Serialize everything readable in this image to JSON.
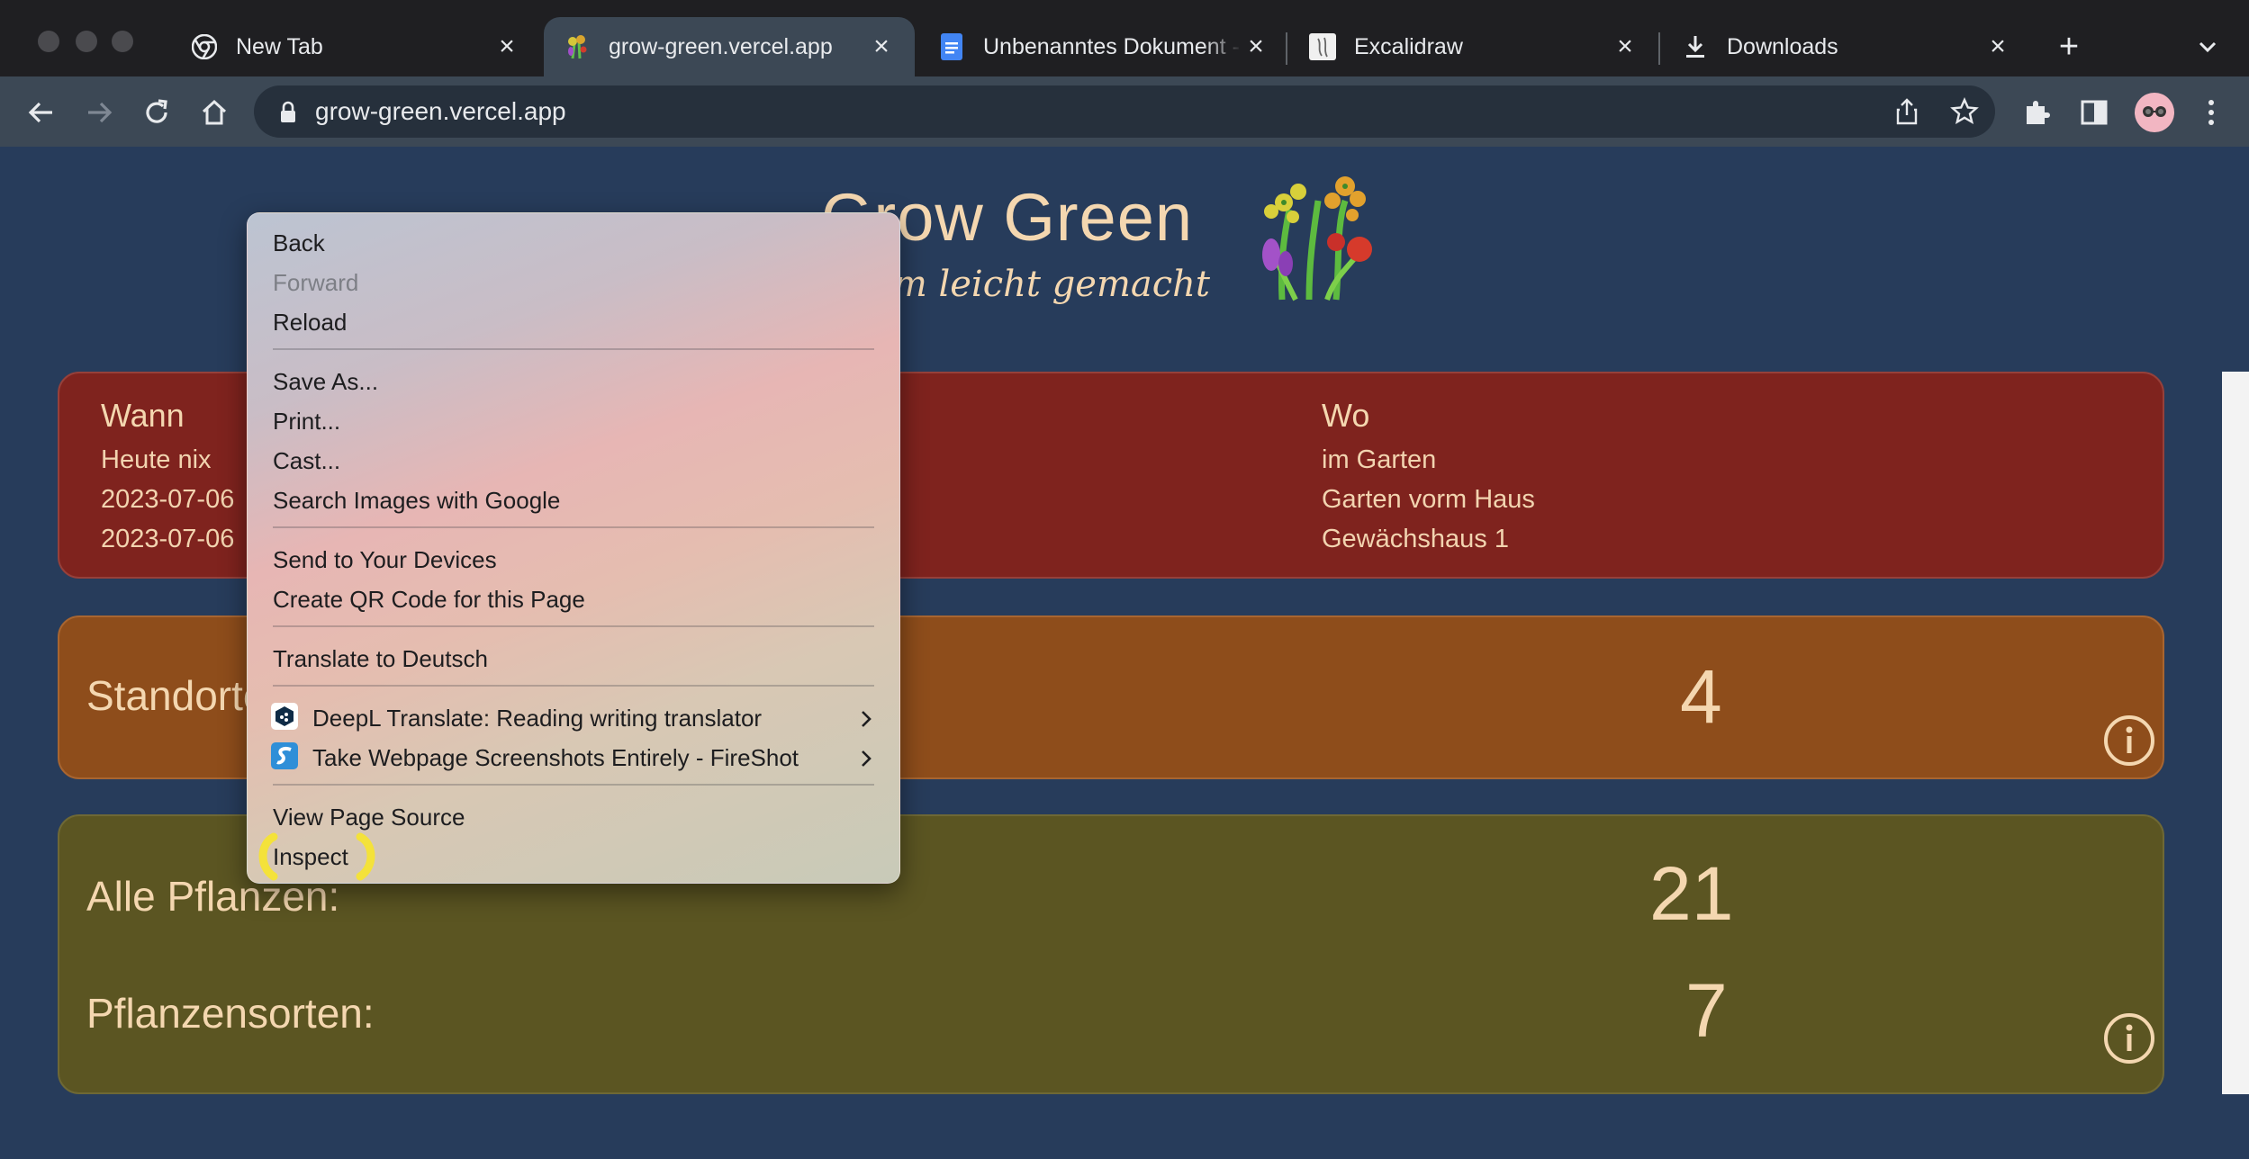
{
  "browser": {
    "tabs": [
      {
        "title": "New Tab",
        "icon": "chrome-icon"
      },
      {
        "title": "grow-green.vercel.app",
        "icon": "plant-favicon-icon",
        "active": true
      },
      {
        "title": "Unbenanntes Dokument -",
        "icon": "google-docs-icon"
      },
      {
        "title": "Excalidraw",
        "icon": "excalidraw-icon"
      },
      {
        "title": "Downloads",
        "icon": "download-icon"
      }
    ],
    "url": "grow-green.vercel.app"
  },
  "page": {
    "title": "Grow Green",
    "subtitle": "...em leicht gemacht",
    "when": {
      "heading": "Wann",
      "lines": [
        "Heute nix",
        "2023-07-06",
        "2023-07-06"
      ]
    },
    "where": {
      "heading": "Wo",
      "lines": [
        "im Garten",
        "Garten vorm Haus",
        "Gewächshaus 1"
      ]
    },
    "locations": {
      "label": "Standorte",
      "value": "4"
    },
    "all_plants": {
      "label": "Alle Pflanzen:",
      "value": "21"
    },
    "plant_types": {
      "label": "Pflanzensorten:",
      "value": "7"
    }
  },
  "context_menu": {
    "back": "Back",
    "forward": "Forward",
    "reload": "Reload",
    "save_as": "Save As...",
    "print": "Print...",
    "cast": "Cast...",
    "search_images": "Search Images with Google",
    "send_devices": "Send to Your Devices",
    "qr_code": "Create QR Code for this Page",
    "translate": "Translate to Deutsch",
    "deepl": "DeepL Translate: Reading  writing translator",
    "fireshot": "Take Webpage Screenshots Entirely - FireShot",
    "view_source": "View Page Source",
    "inspect": "Inspect"
  },
  "colors": {
    "page_bg": "#273c5b",
    "card_red": "#7f231e",
    "card_orange": "#8e4d1b",
    "card_olive": "#5b5522",
    "accent_text": "#f4d7b0",
    "highlight": "#f4e23a"
  }
}
